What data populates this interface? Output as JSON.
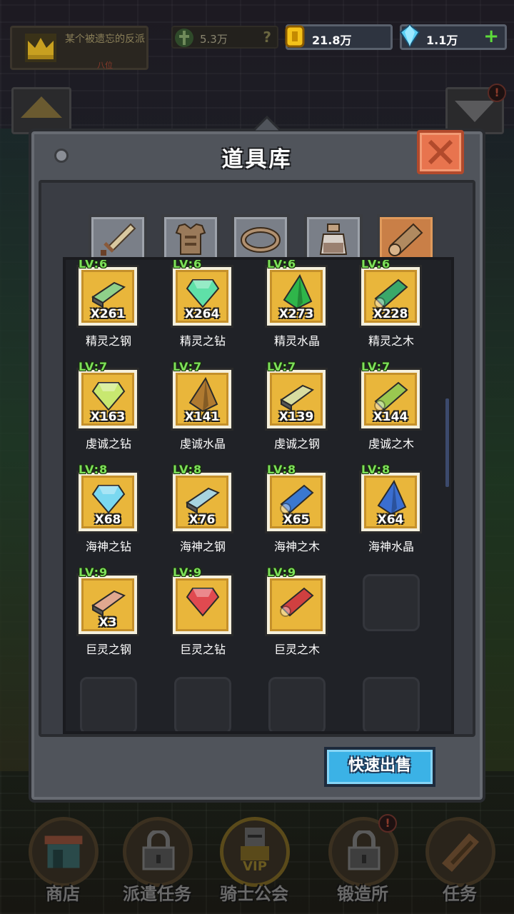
{
  "topbar": {
    "guild_name": "某个被遗忘的反派",
    "guild_sub": "八位",
    "power": "5.3万",
    "help": "?",
    "gold": "21.8万",
    "gems": "1.1万",
    "plus": "+",
    "alert": "!"
  },
  "modal": {
    "title": "道具库",
    "tabs": [
      {
        "name": "weapon",
        "icon": "sword-icon",
        "active": false
      },
      {
        "name": "armor",
        "icon": "armor-icon",
        "active": false
      },
      {
        "name": "accessory",
        "icon": "ring-icon",
        "active": false
      },
      {
        "name": "potion",
        "icon": "potion-icon",
        "active": false
      },
      {
        "name": "material",
        "icon": "log-icon",
        "active": true
      }
    ],
    "quick_sell": "快速出售"
  },
  "items": [
    {
      "lv": "LV:6",
      "qty": "X261",
      "name": "精灵之钢",
      "icon": "steel-bar-icon",
      "color": "#8fd08a"
    },
    {
      "lv": "LV:6",
      "qty": "X264",
      "name": "精灵之钻",
      "icon": "diamond-icon",
      "color": "#5fe0a8"
    },
    {
      "lv": "LV:6",
      "qty": "X273",
      "name": "精灵水晶",
      "icon": "crystal-icon",
      "color": "#2fb64a"
    },
    {
      "lv": "LV:6",
      "qty": "X228",
      "name": "精灵之木",
      "icon": "log-icon",
      "color": "#3aa86a"
    },
    {
      "lv": "LV:7",
      "qty": "X163",
      "name": "虔诚之钻",
      "icon": "diamond-icon",
      "color": "#c8e870"
    },
    {
      "lv": "LV:7",
      "qty": "X141",
      "name": "虔诚水晶",
      "icon": "crystal-icon",
      "color": "#b07a30"
    },
    {
      "lv": "LV:7",
      "qty": "X139",
      "name": "虔诚之钢",
      "icon": "steel-bar-icon",
      "color": "#d8dca0"
    },
    {
      "lv": "LV:7",
      "qty": "X144",
      "name": "虔诚之木",
      "icon": "log-icon",
      "color": "#9ac850"
    },
    {
      "lv": "LV:8",
      "qty": "X68",
      "name": "海神之钻",
      "icon": "diamond-icon",
      "color": "#7ad8f0"
    },
    {
      "lv": "LV:8",
      "qty": "X76",
      "name": "海神之钢",
      "icon": "steel-bar-icon",
      "color": "#a8d4e0"
    },
    {
      "lv": "LV:8",
      "qty": "X65",
      "name": "海神之木",
      "icon": "log-icon",
      "color": "#3a78d0"
    },
    {
      "lv": "LV:8",
      "qty": "X64",
      "name": "海神水晶",
      "icon": "crystal-icon",
      "color": "#3a6ed0"
    },
    {
      "lv": "LV:9",
      "qty": "X3",
      "name": "巨灵之钢",
      "icon": "steel-bar-icon",
      "color": "#e0a890"
    },
    {
      "lv": "LV:9",
      "qty": "",
      "name": "巨灵之钻",
      "icon": "diamond-icon",
      "color": "#e04a50"
    },
    {
      "lv": "LV:9",
      "qty": "",
      "name": "巨灵之木",
      "icon": "log-icon",
      "color": "#d04040"
    }
  ],
  "bottom_nav": [
    {
      "label": "商店",
      "icon": "shop-icon"
    },
    {
      "label": "派遣任务",
      "icon": "lock-icon"
    },
    {
      "label": "骑士公会",
      "icon": "knight-vip-icon",
      "badge": "VIP"
    },
    {
      "label": "锻造所",
      "icon": "lock-icon"
    },
    {
      "label": "任务",
      "icon": "quest-scroll-icon"
    }
  ]
}
